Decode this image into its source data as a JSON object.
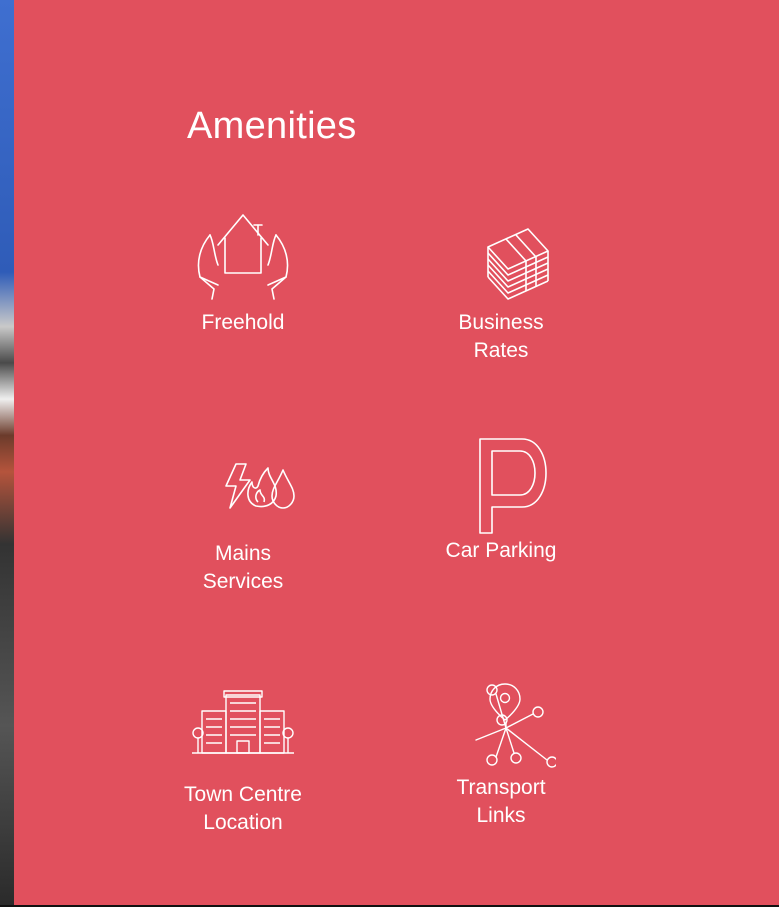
{
  "section": {
    "title": "Amenities"
  },
  "amenities": [
    {
      "label": "Freehold",
      "icon": "hands-house-icon"
    },
    {
      "label": "Business\nRates",
      "icon": "cash-stack-icon"
    },
    {
      "label": "Mains\nServices",
      "icon": "utilities-icon"
    },
    {
      "label": "Car Parking",
      "icon": "parking-icon"
    },
    {
      "label": "Town Centre\nLocation",
      "icon": "buildings-icon"
    },
    {
      "label": "Transport\nLinks",
      "icon": "network-pin-icon"
    }
  ],
  "colors": {
    "background": "#e1505d",
    "foreground": "#ffffff"
  }
}
